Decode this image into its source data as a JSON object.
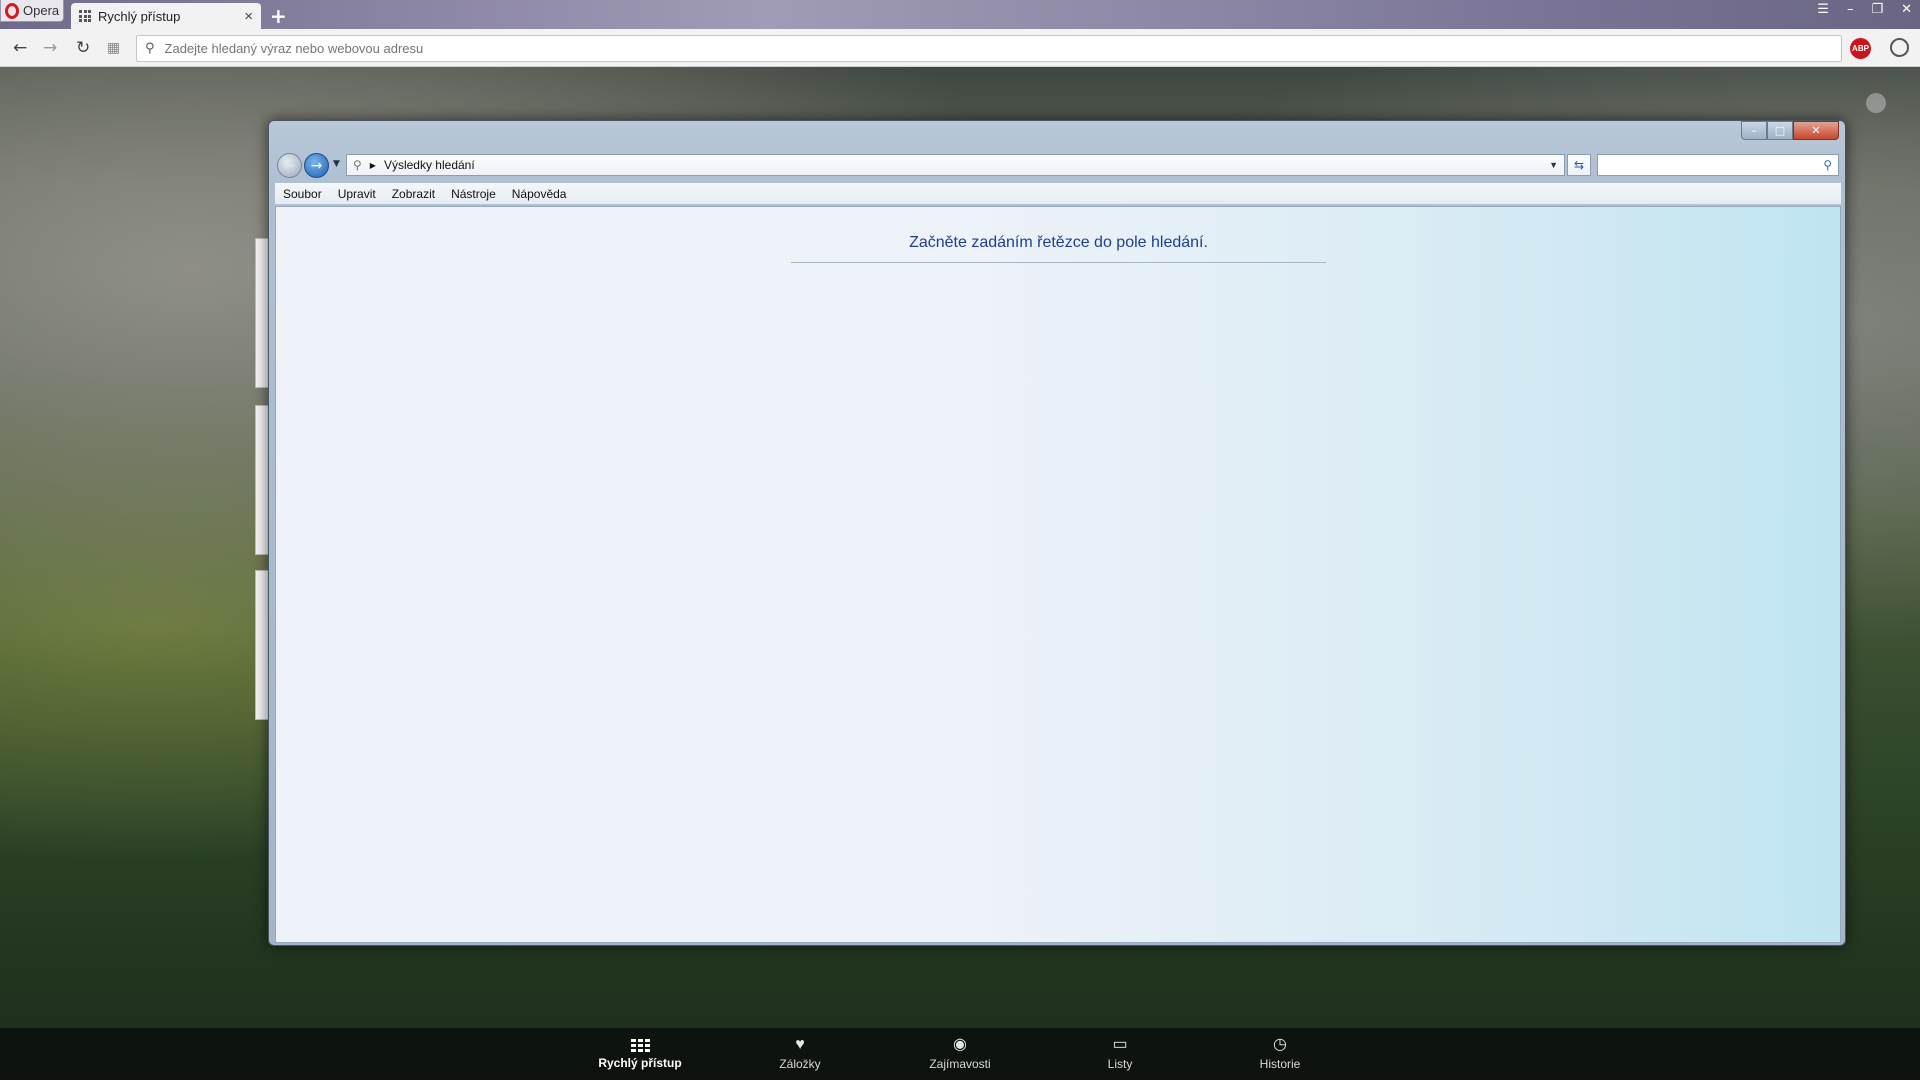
{
  "browser": {
    "menu_label": "Opera",
    "tab": {
      "title": "Rychlý přístup"
    },
    "address": {
      "placeholder": "Zadejte hledaný výraz nebo webovou adresu",
      "value": ""
    },
    "extensions": {
      "adblock_label": "ABP"
    }
  },
  "explorer": {
    "breadcrumb": "Výsledky hledání",
    "search": {
      "value": ""
    },
    "menu": [
      "Soubor",
      "Upravit",
      "Zobrazit",
      "Nástroje",
      "Nápověda"
    ],
    "empty_message": "Začněte zadáním řetězce do pole hledání."
  },
  "bottombar": {
    "items": [
      {
        "label": "Rychlý přístup",
        "icon": "grid-icon",
        "active": true
      },
      {
        "label": "Záložky",
        "icon": "heart-icon",
        "active": false
      },
      {
        "label": "Zajímavosti",
        "icon": "eye-icon",
        "active": false
      },
      {
        "label": "Listy",
        "icon": "devices-icon",
        "active": false
      },
      {
        "label": "Historie",
        "icon": "clock-icon",
        "active": false
      }
    ]
  }
}
